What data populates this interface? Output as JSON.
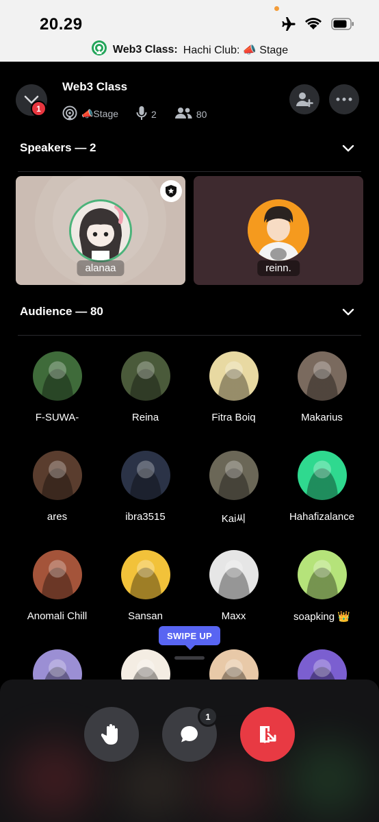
{
  "status_bar": {
    "time": "20.29",
    "banner_bold": "Web3 Class:",
    "banner_rest": "Hachi Club: 📣 Stage"
  },
  "header": {
    "channel_title": "Web3 Class",
    "collapse_badge": "1",
    "stage_label": "📣Stage",
    "speakers_count": "2",
    "listeners_count": "80"
  },
  "speakers": {
    "heading": "Speakers — 2",
    "items": [
      {
        "name": "alanaa",
        "color": "#cbbcb3",
        "moderator": true
      },
      {
        "name": "reinn.",
        "color": "#3e2a2f",
        "moderator": false
      }
    ]
  },
  "audience": {
    "heading": "Audience — 80",
    "items": [
      {
        "name": "F-SUWA-",
        "color": "#3f6b3a"
      },
      {
        "name": "Reina",
        "color": "#4a5a3a"
      },
      {
        "name": "Fitra Boiq",
        "color": "#e8d9a2"
      },
      {
        "name": "Makarius",
        "color": "#7a6a5e"
      },
      {
        "name": "ares",
        "color": "#5a3d2e"
      },
      {
        "name": "ibra3515",
        "color": "#2b3347"
      },
      {
        "name": "Kai씨",
        "color": "#6b6757"
      },
      {
        "name": "Hahafizalance",
        "color": "#2fd98f"
      },
      {
        "name": "Anomali Chill",
        "color": "#a4543a"
      },
      {
        "name": "Sansan",
        "color": "#f2c23a"
      },
      {
        "name": "Maxx",
        "color": "#e6e6e6"
      },
      {
        "name": "soapking 👑",
        "color": "#b5e37a"
      },
      {
        "name": "",
        "color": "#9b8fd4"
      },
      {
        "name": "",
        "color": "#f4ede3"
      },
      {
        "name": "",
        "color": "#e8c9a8"
      },
      {
        "name": "",
        "color": "#7b5fd0"
      }
    ]
  },
  "swipe_tip": "SWIPE UP",
  "controls": {
    "chat_badge": "1"
  }
}
